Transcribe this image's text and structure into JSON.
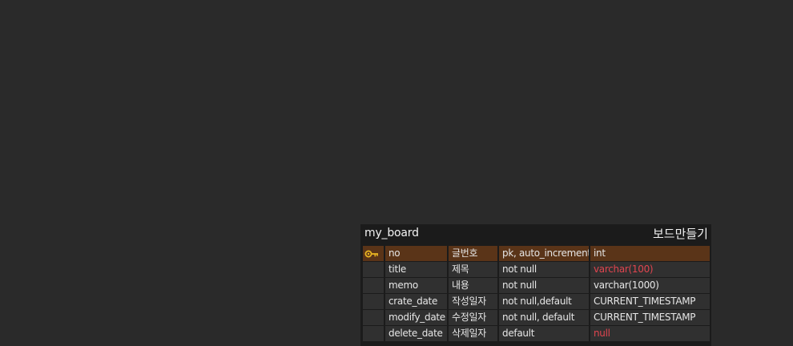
{
  "colors": {
    "background": "#2a2a2a",
    "card": "#1b1b1b",
    "cell": "#303030",
    "pk_row": "#5a3418",
    "text": "#e6e6e6",
    "highlight_type": "#e0454f",
    "key_icon": "#e8b422"
  },
  "table": {
    "name": "my_board",
    "comment": "보드만들기",
    "columns": [
      {
        "name": "no",
        "comment": "글번호",
        "options": "pk, auto_increment",
        "type": "int",
        "pk": true,
        "icon": "key-icon",
        "type_highlight": false
      },
      {
        "name": "title",
        "comment": "제목",
        "options": "not null",
        "type": "varchar(100)",
        "pk": false,
        "type_highlight": true
      },
      {
        "name": "memo",
        "comment": "내용",
        "options": "not null",
        "type": "varchar(1000)",
        "pk": false,
        "type_highlight": false
      },
      {
        "name": "crate_date",
        "comment": "작성일자",
        "options": "not null,default",
        "type": "CURRENT_TIMESTAMP",
        "pk": false,
        "type_highlight": false
      },
      {
        "name": "modify_date",
        "comment": "수정일자",
        "options": "not null, default",
        "type": "CURRENT_TIMESTAMP",
        "pk": false,
        "type_highlight": false
      },
      {
        "name": "delete_date",
        "comment": "삭제일자",
        "options": "default",
        "type": "null",
        "pk": false,
        "type_highlight": true
      }
    ]
  }
}
